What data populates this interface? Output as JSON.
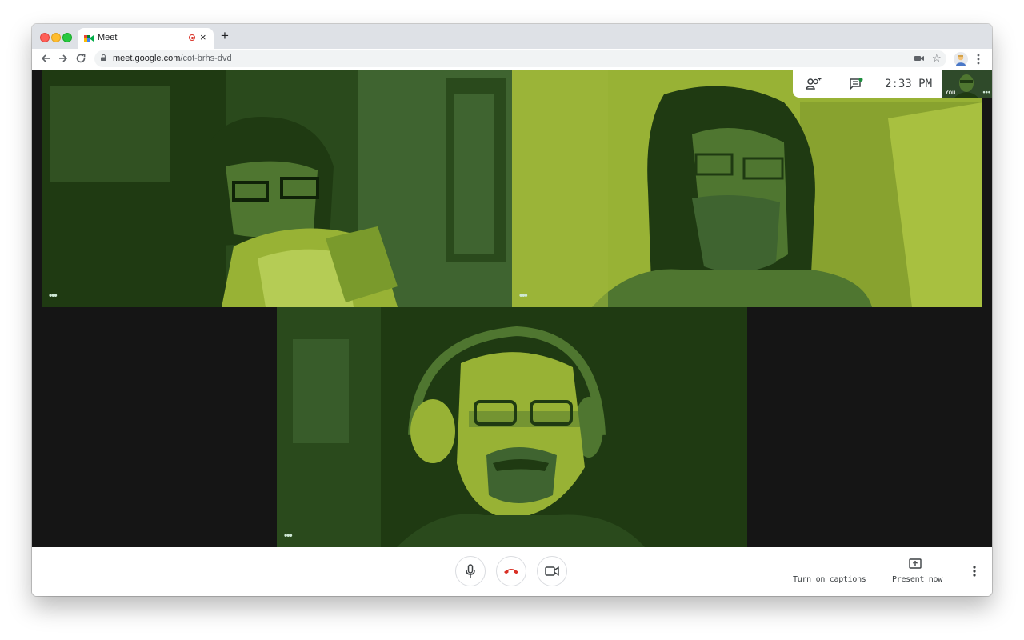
{
  "browser": {
    "tab_title": "Meet",
    "new_tab_label": "+",
    "close_label": "×",
    "url_host": "meet.google.com",
    "url_path": "/cot-brhs-dvd"
  },
  "meeting": {
    "clock": "2:33 PM",
    "self_label": "You",
    "tile_more": "•••",
    "participants_icon": "people-add-icon",
    "chat_icon": "chat-icon"
  },
  "controls": {
    "mic_icon": "microphone-icon",
    "hangup_icon": "hang-up-icon",
    "camera_icon": "video-camera-icon",
    "captions_label": "Turn on captions",
    "present_label": "Present now",
    "more_icon": "more-vertical-icon"
  },
  "colors": {
    "dark_green": "#1f3a12",
    "mid_green": "#3f6430",
    "light_green": "#98b235",
    "hangup_red": "#d93025",
    "stage_bg": "#151515"
  }
}
